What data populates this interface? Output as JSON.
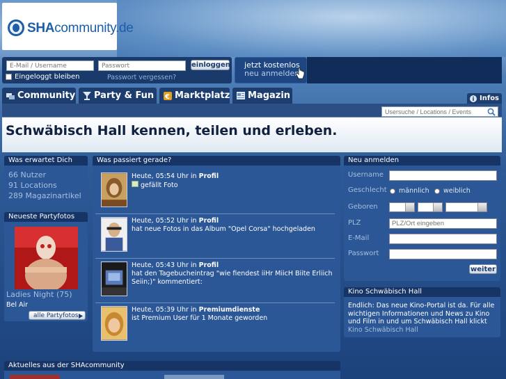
{
  "brand": {
    "name_bold": "SHA",
    "name_rest": "community.de"
  },
  "login": {
    "user_placeholder": "E-Mail / Username",
    "pass_placeholder": "Passwort",
    "login_button": "einloggen",
    "remember": "Eingeloggt bleiben",
    "forgot": "Passwort vergessen?",
    "register_line1": "jetzt kostenlos",
    "register_line2": "neu anmelden"
  },
  "nav": {
    "tabs": [
      "Community",
      "Party & Fun",
      "Marktplatz",
      "Magazin"
    ],
    "info": "Infos",
    "search_placeholder": "Usersuche / Locations / Events"
  },
  "hero": {
    "title": "Schwäbisch Hall kennen, teilen und erleben."
  },
  "expect": {
    "title": "Was erwartet Dich",
    "lines": [
      "66 Nutzer",
      "91 Locations",
      "289 Magazinartikel"
    ]
  },
  "partyfotos": {
    "title": "Neueste Partyfotos",
    "caption": "Ladies Night (75)",
    "location": "Bel Air",
    "button": "alle Partyfotos"
  },
  "feed": {
    "title": "Was passiert gerade?",
    "items": [
      {
        "time": "Heute, 05:54 Uhr in",
        "section": "Profil",
        "text": "gefällt Foto"
      },
      {
        "time": "Heute, 05:52 Uhr in",
        "section": "Profil",
        "text": "hat neue Fotos in das Album \"Opel Corsa\" hochgeladen"
      },
      {
        "time": "Heute, 05:43 Uhr in",
        "section": "Profil",
        "text": "hat den Tagebucheintrag \"wie fiendest iiHr MiicH Biite Erliich Seiin;)\" kommentiert:"
      },
      {
        "time": "Heute, 05:39 Uhr in",
        "section": "Premiumdienste",
        "text": "ist Premium User für 1 Monate geworden"
      }
    ]
  },
  "signup": {
    "title": "Neu anmelden",
    "username": "Username",
    "gender": "Geschlecht",
    "male": "männlich",
    "female": "weiblich",
    "born": "Geboren",
    "plz": "PLZ",
    "plz_placeholder": "PLZ/Ort eingeben",
    "email": "E-Mail",
    "password": "Passwort",
    "button": "weiter"
  },
  "kino": {
    "title": "Kino Schwäbisch Hall",
    "text": "Endlich: Das neue Kino-Portal ist da. Für alle wichtigen Informationen und News zu Kino und Film in und um Schwäbisch Hall klickt",
    "link": "Kino Schwäbisch Hall"
  },
  "news": {
    "title": "Aktuelles aus der SHAcommunity"
  },
  "colors": {
    "accent": "#1d5ea8",
    "panel": "#2c5796",
    "panel_head": "#163466"
  }
}
